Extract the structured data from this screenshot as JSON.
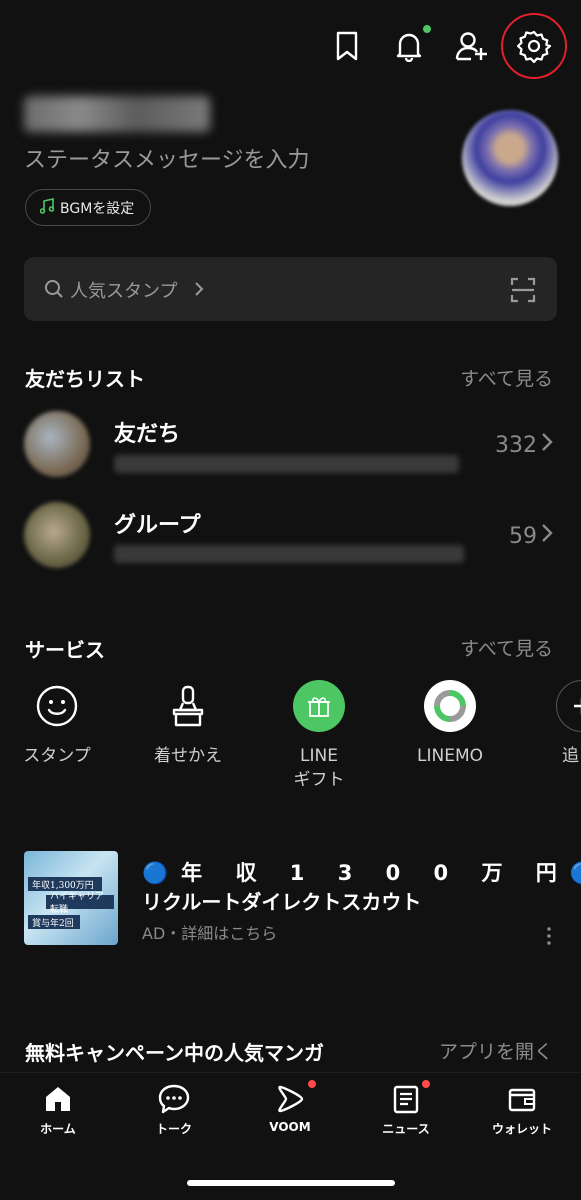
{
  "profile": {
    "status_message": "ステータスメッセージを入力",
    "bgm_button": "BGMを設定"
  },
  "search": {
    "placeholder": "人気スタンプ"
  },
  "friends_section": {
    "title": "友だちリスト",
    "see_all": "すべて見る",
    "rows": [
      {
        "title": "友だち",
        "count": "332"
      },
      {
        "title": "グループ",
        "count": "59"
      }
    ]
  },
  "services_section": {
    "title": "サービス",
    "see_all": "すべて見る",
    "items": [
      {
        "label": "スタンプ",
        "icon": "smiley-icon"
      },
      {
        "label": "着せかえ",
        "icon": "brush-icon"
      },
      {
        "label": "LINE\nギフト",
        "icon": "gift-icon"
      },
      {
        "label": "LINEMO",
        "icon": "linemo-icon"
      },
      {
        "label": "追",
        "icon": "add-icon"
      }
    ]
  },
  "ad": {
    "title_line1": "🔵年 収 1 3 0 0 万 円🔵",
    "title_line2": "リクルートダイレクトスカウト",
    "subtitle": "AD・詳細はこちら",
    "thumb_lines": [
      "年収1,300万円",
      "ハイキャリア転職",
      "賞与年2回"
    ]
  },
  "manga_section": {
    "title": "無料キャンペーン中の人気マンガ",
    "action": "アプリを開く"
  },
  "bottom_nav": [
    {
      "label": "ホーム",
      "icon": "home-icon",
      "active": true
    },
    {
      "label": "トーク",
      "icon": "chat-icon"
    },
    {
      "label": "VOOM",
      "icon": "voom-icon",
      "badge": true
    },
    {
      "label": "ニュース",
      "icon": "news-icon",
      "badge": true
    },
    {
      "label": "ウォレット",
      "icon": "wallet-icon"
    }
  ],
  "colors": {
    "accent_green": "#4cc764",
    "badge_red": "#ff4b4b",
    "highlight_red": "#e0202a"
  }
}
